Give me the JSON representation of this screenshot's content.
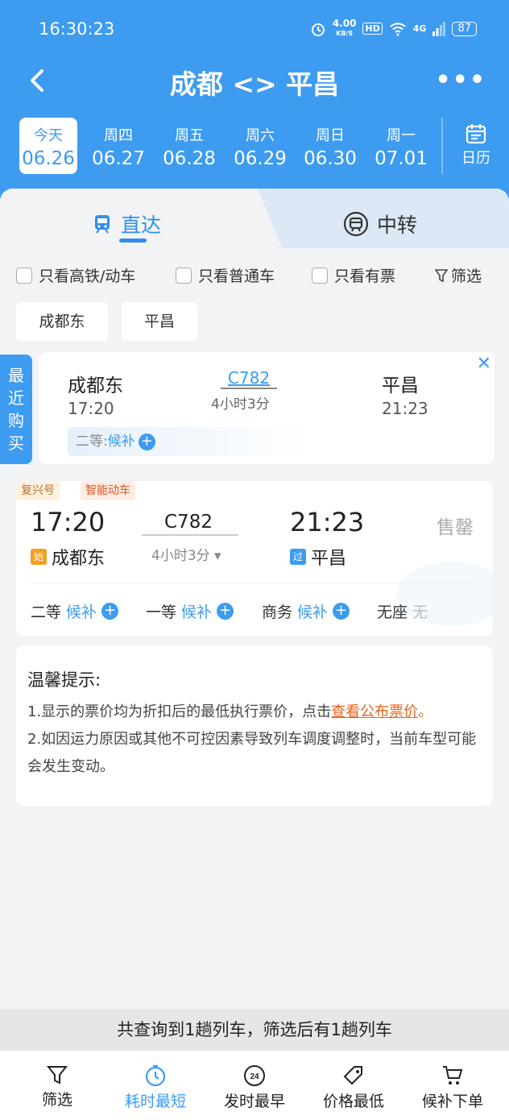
{
  "status_bar": {
    "time": "16:30:23",
    "speed": "4.00",
    "speed_unit": "KB/S",
    "hd": "HD",
    "net": "4G",
    "battery": "87"
  },
  "header": {
    "title": "成都 <> 平昌"
  },
  "dates": [
    {
      "week": "今天",
      "date": "06.26",
      "selected": true
    },
    {
      "week": "周四",
      "date": "06.27"
    },
    {
      "week": "周五",
      "date": "06.28"
    },
    {
      "week": "周六",
      "date": "06.29"
    },
    {
      "week": "周日",
      "date": "06.30"
    },
    {
      "week": "周一",
      "date": "07.01"
    }
  ],
  "calendar_label": "日历",
  "tabs": {
    "direct": "直达",
    "transfer": "中转"
  },
  "filters": {
    "high_speed": "只看高铁/动车",
    "normal": "只看普通车",
    "available": "只看有票",
    "filter": "筛选"
  },
  "stations": [
    "成都东",
    "平昌"
  ],
  "recent": {
    "tag": [
      "最",
      "近",
      "购",
      "买"
    ],
    "from": "成都东",
    "from_time": "17:20",
    "train": "C782",
    "duration": "4小时3分",
    "to": "平昌",
    "to_time": "21:23",
    "seat": "二等:",
    "seat_status": "候补"
  },
  "train": {
    "tag1": "复兴号",
    "tag2": "智能动车",
    "dep_time": "17:20",
    "dep_station": "成都东",
    "dep_badge": "始",
    "number": "C782",
    "duration": "4小时3分",
    "arr_time": "21:23",
    "arr_station": "平昌",
    "arr_badge": "过",
    "status": "售罄",
    "seats": [
      {
        "name": "二等",
        "value": "候补",
        "plus": true
      },
      {
        "name": "一等",
        "value": "候补",
        "plus": true
      },
      {
        "name": "商务",
        "value": "候补",
        "plus": true
      },
      {
        "name": "无座",
        "value": "无",
        "plus": false
      }
    ]
  },
  "tip": {
    "title": "温馨提示:",
    "line1": "1.显示的票价均为折扣后的最低执行票价，点击",
    "line1_link": "查看公布票价",
    "line1_end": "。",
    "line2": "2.如因运力原因或其他不可控因素导致列车调度调整时，当前车型可能会发生变动。"
  },
  "summary": "共查询到1趟列车，筛选后有1趟列车",
  "bottom_nav": [
    "筛选",
    "耗时最短",
    "发时最早",
    "价格最低",
    "候补下单"
  ],
  "colors": {
    "primary": "#3d9bf0",
    "link": "#e9621a"
  }
}
